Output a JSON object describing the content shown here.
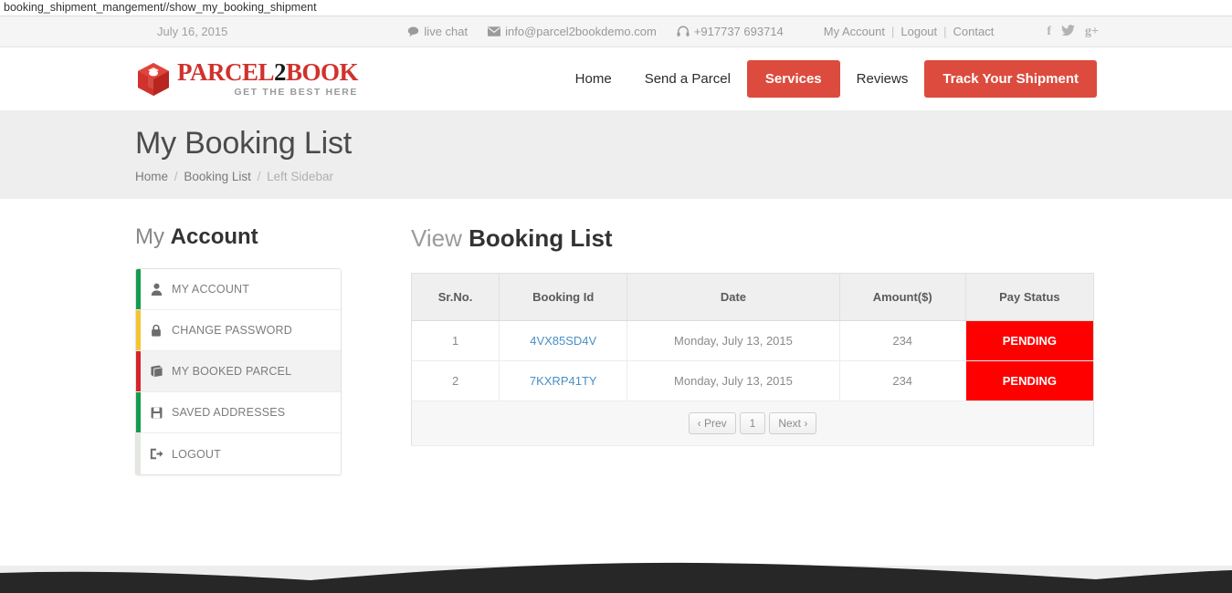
{
  "browser": {
    "url_text": "booking_shipment_mangement//show_my_booking_shipment"
  },
  "topbar": {
    "date": "July 16, 2015",
    "live_chat": "live chat",
    "email": "info@parcel2bookdemo.com",
    "phone": "+917737 693714",
    "my_account": "My Account",
    "logout": "Logout",
    "contact": "Contact",
    "separator": "|",
    "social": [
      {
        "name": "facebook-icon",
        "glyph": "f"
      },
      {
        "name": "twitter-icon",
        "glyph": "t"
      },
      {
        "name": "google-plus-icon",
        "glyph": "g+"
      }
    ]
  },
  "brand": {
    "word_1": "PARCEL",
    "word_2": "2",
    "word_3": "BOOK",
    "tagline": "GET THE BEST HERE",
    "red": "#d0322c",
    "black": "#1a1a1a"
  },
  "nav": {
    "items": [
      {
        "label": "Home",
        "style": "plain"
      },
      {
        "label": "Send a Parcel",
        "style": "plain"
      },
      {
        "label": "Services",
        "style": "active"
      },
      {
        "label": "Reviews",
        "style": "plain"
      },
      {
        "label": "Track Your Shipment",
        "style": "cta"
      }
    ],
    "accent": "#dd4b3e"
  },
  "page": {
    "title": "My Booking List",
    "breadcrumb": {
      "home": "Home",
      "booking_list": "Booking List",
      "current": "Left Sidebar",
      "sep": "/"
    }
  },
  "sidebar": {
    "heading_light": "My",
    "heading_bold": "Account",
    "items": [
      {
        "label": "MY ACCOUNT",
        "icon": "user-icon",
        "bar": "#159b4d",
        "active": false
      },
      {
        "label": "CHANGE PASSWORD",
        "icon": "lock-icon",
        "bar": "#f5c431",
        "active": false
      },
      {
        "label": "MY BOOKED PARCEL",
        "icon": "book-icon",
        "bar": "#d8232a",
        "active": true
      },
      {
        "label": "SAVED ADDRESSES",
        "icon": "save-icon",
        "bar": "#159b4d",
        "active": false
      },
      {
        "label": "LOGOUT",
        "icon": "logout-icon",
        "bar": "#e3e8e0",
        "active": false
      }
    ]
  },
  "main": {
    "heading_light": "View",
    "heading_bold": "Booking List",
    "table": {
      "columns": [
        "Sr.No.",
        "Booking Id",
        "Date",
        "Amount($)",
        "Pay Status"
      ],
      "rows": [
        {
          "sr": "1",
          "booking_id": "4VX85SD4V",
          "date": "Monday, July 13, 2015",
          "amount": "234",
          "pay_status": "PENDING"
        },
        {
          "sr": "2",
          "booking_id": "7KXRP41TY",
          "date": "Monday, July 13, 2015",
          "amount": "234",
          "pay_status": "PENDING"
        }
      ],
      "status_color": "#fe0000",
      "link_color": "#4a90c4"
    },
    "pagination": {
      "prev": "‹ Prev",
      "page": "1",
      "next": "Next ›"
    }
  },
  "footer": {
    "wave_color": "#272727",
    "band_color": "#eeeeee"
  }
}
